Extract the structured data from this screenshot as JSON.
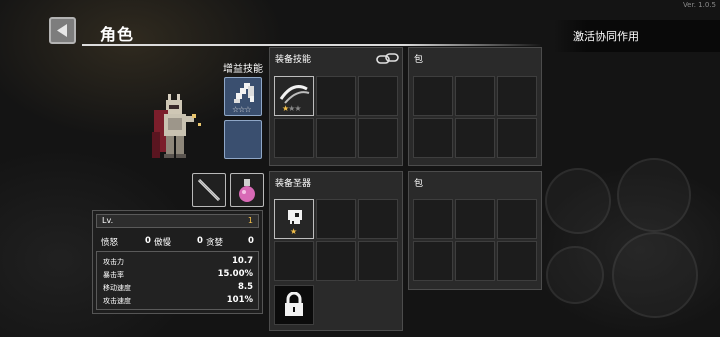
{
  "version": "Ver. 1.0.5",
  "header": {
    "title": "角色",
    "activate_label": "激活协同作用"
  },
  "boost": {
    "label": "增益技能",
    "slot_icon": "pixel-arm-icon",
    "stars": [
      "☆",
      "☆",
      "☆"
    ]
  },
  "gear": {
    "weapon_icon": "sword-icon",
    "item_icon": "potion-icon"
  },
  "stats": {
    "lv_label": "Lv.",
    "lv_value": "1",
    "traits": [
      {
        "label": "愤怒",
        "value": "0"
      },
      {
        "label": "傲慢",
        "value": "0"
      },
      {
        "label": "贪婪",
        "value": "0"
      }
    ],
    "rows": [
      {
        "label": "攻击力",
        "value": "10.7"
      },
      {
        "label": "暴击率",
        "value": "15.00%"
      },
      {
        "label": "移动速度",
        "value": "8.5"
      },
      {
        "label": "攻击速度",
        "value": "101%"
      }
    ]
  },
  "skills_panel": {
    "title": "装备技能",
    "link_icon": "chain-link-icon",
    "skill_icon": "slash-icon",
    "stars": [
      "★",
      "★",
      "★"
    ]
  },
  "bag_top": {
    "title": "包"
  },
  "relics_panel": {
    "title": "装备圣器",
    "relic_icon": "skull-icon",
    "stars": [
      "★"
    ],
    "lock_icon": "lock-icon"
  },
  "bag_bottom": {
    "title": "包"
  },
  "colors": {
    "star_active": "#f3c04a",
    "slot_blue": "#3a4f6f",
    "accent_gold": "#f3c04a"
  }
}
